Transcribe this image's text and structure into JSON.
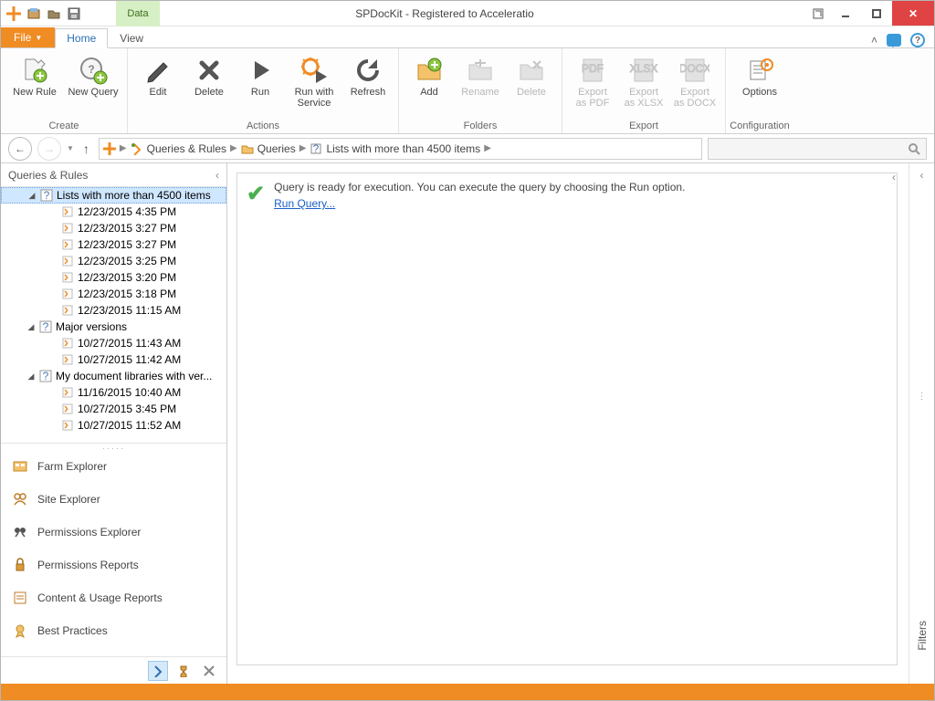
{
  "title": "SPDocKit - Registered to Acceleratio",
  "context_tab": "Data",
  "tabs": {
    "file": "File",
    "home": "Home",
    "view": "View"
  },
  "ribbon": {
    "create": {
      "label": "Create",
      "new_rule": "New Rule",
      "new_query": "New Query"
    },
    "actions": {
      "label": "Actions",
      "edit": "Edit",
      "delete": "Delete",
      "run": "Run",
      "run_with_service": "Run with\nService",
      "refresh": "Refresh"
    },
    "folders": {
      "label": "Folders",
      "add": "Add",
      "rename": "Rename",
      "delete": "Delete"
    },
    "export": {
      "label": "Export",
      "pdf": "Export\nas PDF",
      "xlsx": "Export\nas XLSX",
      "docx": "Export\nas DOCX"
    },
    "config": {
      "label": "Configuration",
      "options": "Options"
    }
  },
  "breadcrumb": {
    "root": "Queries & Rules",
    "folder": "Queries",
    "item": "Lists with more than 4500 items"
  },
  "left": {
    "header": "Queries & Rules",
    "nodes": [
      {
        "label": "Lists with more than 4500 items",
        "selected": true,
        "children": [
          "12/23/2015 4:35 PM",
          "12/23/2015 3:27 PM",
          "12/23/2015 3:27 PM",
          "12/23/2015 3:25 PM",
          "12/23/2015 3:20 PM",
          "12/23/2015 3:18 PM",
          "12/23/2015 11:15 AM"
        ]
      },
      {
        "label": "Major versions",
        "children": [
          "10/27/2015 11:43 AM",
          "10/27/2015 11:42 AM"
        ]
      },
      {
        "label": "My document libraries with ver...",
        "children": [
          "11/16/2015 10:40 AM",
          "10/27/2015 3:45 PM",
          "10/27/2015 11:52 AM"
        ]
      }
    ],
    "nav": [
      "Farm Explorer",
      "Site Explorer",
      "Permissions Explorer",
      "Permissions Reports",
      "Content & Usage Reports",
      "Best Practices"
    ]
  },
  "message": {
    "text": "Query is ready for execution. You can execute the query by choosing the Run option.",
    "link": "Run Query..."
  },
  "filters": "Filters"
}
